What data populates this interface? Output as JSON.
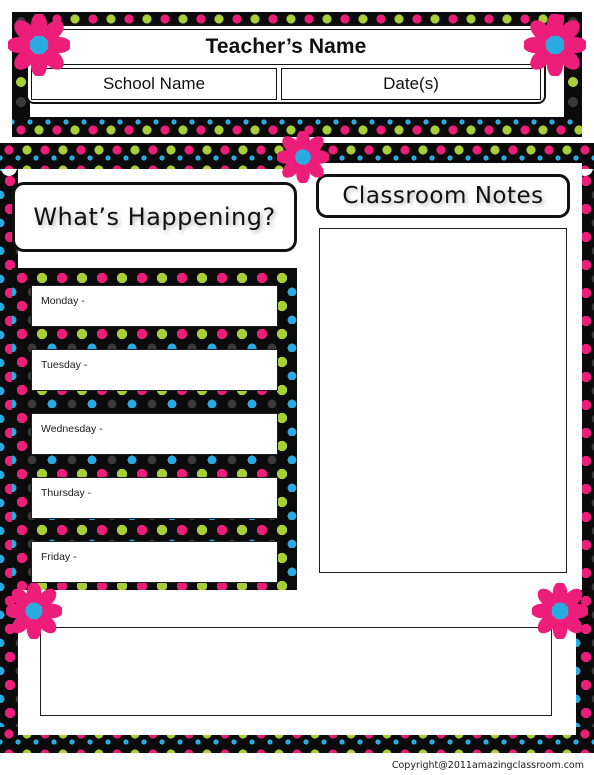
{
  "document": {
    "type": "classroom-newsletter-template",
    "colors": {
      "pink": "#ED1E79",
      "green": "#A8CF38",
      "blue": "#29ABE2",
      "dark": "#3a3a3a",
      "black": "#0b0b0b",
      "paper": "#ffffff"
    }
  },
  "header": {
    "teacher_name_label": "Teacher’s Name",
    "school_name_label": "School Name",
    "dates_label": "Date(s)"
  },
  "left_column": {
    "section_title": "What’s Happening?",
    "days": [
      {
        "label": "Monday -"
      },
      {
        "label": "Tuesday -"
      },
      {
        "label": "Wednesday -"
      },
      {
        "label": "Thursday -"
      },
      {
        "label": "Friday -"
      }
    ]
  },
  "right_column": {
    "section_title": "Classroom Notes",
    "notes_value": ""
  },
  "bottom": {
    "note_value": ""
  },
  "footer": {
    "copyright": "Copyright@2011amazingclassroom.com"
  },
  "decorations": {
    "flower_icon": "flower-icon",
    "flower_count": 5
  }
}
